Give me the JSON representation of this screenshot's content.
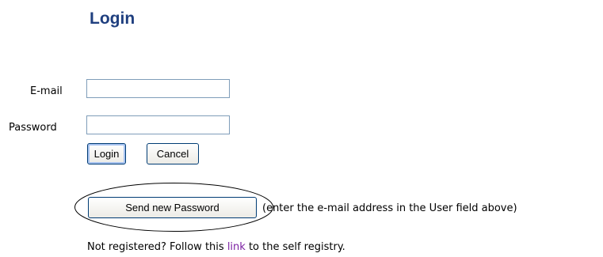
{
  "page": {
    "title": "Login"
  },
  "form": {
    "email_label": "E-mail",
    "email_value": "",
    "password_label": "Password",
    "password_value": "",
    "login_button": "Login",
    "cancel_button": "Cancel",
    "send_password_button": "Send new Password",
    "send_password_hint": "(enter the e-mail address in the User field above)"
  },
  "registration": {
    "prefix": "Not registered? Follow this ",
    "link_text": "link",
    "suffix": " to the self registry."
  },
  "colors": {
    "title": "#1f3f7f",
    "link": "#7b1fa2",
    "field_border": "#7f9db9",
    "button_border": "#003c74"
  }
}
